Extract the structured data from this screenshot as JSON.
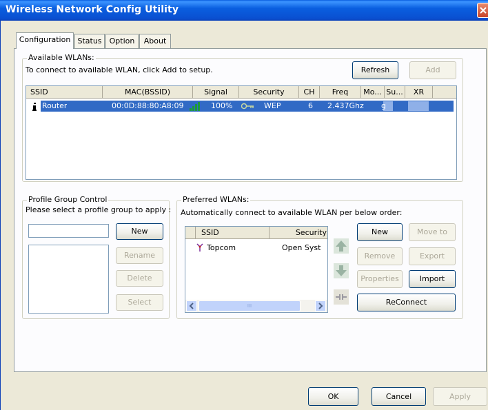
{
  "window": {
    "title": "Wireless Network Config Utility"
  },
  "tabs": [
    {
      "label": "Configuration"
    },
    {
      "label": "Status"
    },
    {
      "label": "Option"
    },
    {
      "label": "About"
    }
  ],
  "available": {
    "title": "Available WLANs:",
    "instruction": "To connect to available WLAN, click Add to setup.",
    "refresh_label": "Refresh",
    "add_label": "Add",
    "columns": [
      "SSID",
      "MAC(BSSID)",
      "Signal",
      "Security",
      "CH",
      "Freq",
      "Mo...",
      "Su...",
      "XR"
    ],
    "rows": [
      {
        "ssid": "Router",
        "mac": "00:0D:88:80:A8:09",
        "signal": "100%",
        "security": "WEP",
        "ch": "6",
        "freq": "2.437Ghz",
        "mode": "g",
        "su": "",
        "xr": ""
      }
    ]
  },
  "profile_group": {
    "title": "Profile Group Control",
    "instruction": "Please select a profile group to apply :",
    "input_value": "",
    "new_label": "New",
    "rename_label": "Rename",
    "delete_label": "Delete",
    "select_label": "Select"
  },
  "preferred": {
    "title": "Preferred WLANs:",
    "instruction": "Automatically connect to available WLAN per below order:",
    "columns": [
      "SSID",
      "Security"
    ],
    "rows": [
      {
        "ssid": "Topcom",
        "security": "Open Syst"
      }
    ],
    "new_label": "New",
    "move_to_label": "Move to",
    "remove_label": "Remove",
    "export_label": "Export",
    "properties_label": "Properties",
    "import_label": "Import",
    "reconnect_label": "ReConnect",
    "scroll_thumb_glyph": "III"
  },
  "footer": {
    "ok_label": "OK",
    "cancel_label": "Cancel",
    "apply_label": "Apply"
  },
  "colors": {
    "title_bar": "#0a5fe0",
    "selection": "#316ac5",
    "window_bg": "#ece9d8"
  }
}
